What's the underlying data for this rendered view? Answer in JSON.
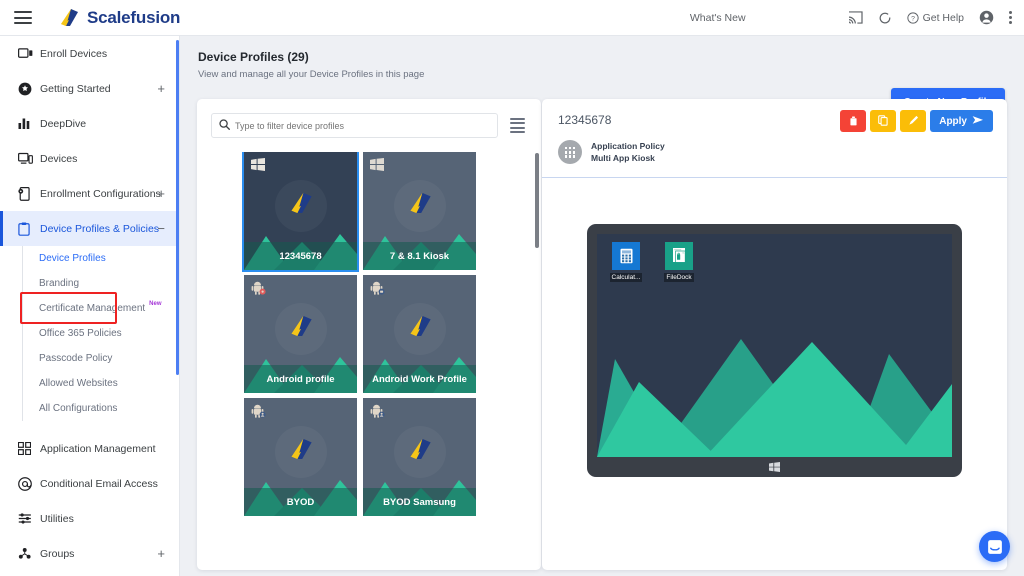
{
  "topbar": {
    "brand": "Scalefusion",
    "whats_new": "What's New",
    "get_help": "Get Help",
    "icons": [
      "menu-icon",
      "apps-grid-icon",
      "cast-icon",
      "sync-icon",
      "help-circle-icon",
      "account-icon",
      "kebab-menu-icon"
    ]
  },
  "sidebar": {
    "items": [
      {
        "label": "Enroll Devices",
        "icon": "enroll-devices-icon",
        "expandable": false,
        "active": false
      },
      {
        "label": "Getting Started",
        "icon": "getting-started-icon",
        "expandable": true,
        "expander": "+",
        "active": false
      },
      {
        "label": "DeepDive",
        "icon": "deepdive-icon",
        "expandable": false,
        "active": false
      },
      {
        "label": "Devices",
        "icon": "devices-icon",
        "expandable": false,
        "active": false
      },
      {
        "label": "Enrollment Configurations",
        "icon": "enrollment-config-icon",
        "expandable": true,
        "expander": "+",
        "active": false
      },
      {
        "label": "Device Profiles & Policies",
        "icon": "clipboard-icon",
        "expandable": true,
        "expander": "−",
        "active": true
      }
    ],
    "subitems": [
      {
        "label": "Device Profiles",
        "selected": true,
        "badge": ""
      },
      {
        "label": "Branding",
        "selected": false,
        "badge": ""
      },
      {
        "label": "Certificate Management",
        "selected": false,
        "badge": "New"
      },
      {
        "label": "Office 365 Policies",
        "selected": false,
        "badge": ""
      },
      {
        "label": "Passcode Policy",
        "selected": false,
        "badge": ""
      },
      {
        "label": "Allowed Websites",
        "selected": false,
        "badge": ""
      },
      {
        "label": "All Configurations",
        "selected": false,
        "badge": ""
      }
    ],
    "items_bottom": [
      {
        "label": "Application Management",
        "icon": "app-management-icon",
        "expandable": false
      },
      {
        "label": "Conditional Email Access",
        "icon": "email-access-icon",
        "expandable": false
      },
      {
        "label": "Utilities",
        "icon": "utilities-icon",
        "expandable": false
      },
      {
        "label": "Groups",
        "icon": "groups-icon",
        "expandable": true,
        "expander": "+"
      }
    ]
  },
  "page": {
    "title": "Device Profiles (29)",
    "subtitle": "View and manage all your Device Profiles in this page",
    "create_button": "Create New Profile"
  },
  "filter": {
    "placeholder": "Type to filter device profiles",
    "value": "",
    "search_icon": "search-icon",
    "view_toggle_icon": "list-view-icon"
  },
  "profiles": [
    {
      "name": "12345678",
      "os": "windows",
      "selected": true
    },
    {
      "name": "7 & 8.1 Kiosk",
      "os": "windows",
      "selected": false
    },
    {
      "name": "Android profile",
      "os": "android",
      "selected": false
    },
    {
      "name": "Android Work Profile",
      "os": "android-work",
      "selected": false
    },
    {
      "name": "BYOD",
      "os": "android-byod",
      "selected": false
    },
    {
      "name": "BYOD Samsung",
      "os": "android-byod",
      "selected": false
    }
  ],
  "detail": {
    "title": "12345678",
    "policy_type": "Application Policy",
    "policy_mode": "Multi App Kiosk",
    "actions": [
      {
        "name": "delete",
        "label": "",
        "icon": "trash-icon",
        "color": "#f44336"
      },
      {
        "name": "copy",
        "label": "",
        "icon": "copy-icon",
        "color": "#fbbd08"
      },
      {
        "name": "edit",
        "label": "",
        "icon": "pencil-icon",
        "color": "#fbbd08"
      }
    ],
    "apply_label": "Apply",
    "apply_icon": "send-icon",
    "preview": {
      "device": "windows-monitor",
      "apps": [
        {
          "label": "Calculat...",
          "icon": "calculator-icon",
          "color": "#1578d3"
        },
        {
          "label": "FileDock",
          "icon": "filedock-icon",
          "color": "#19a188"
        }
      ]
    }
  },
  "chat": {
    "icon": "chat-bubble-icon",
    "color": "#2b6cf6"
  },
  "colors": {
    "accent": "#2b6cf6",
    "active_nav_bg": "#e6edfd",
    "annotation_red": "#ee2222",
    "brand_navy": "#1f3c88",
    "brand_gold": "#f5c518",
    "page_bg": "#eef0f4"
  }
}
